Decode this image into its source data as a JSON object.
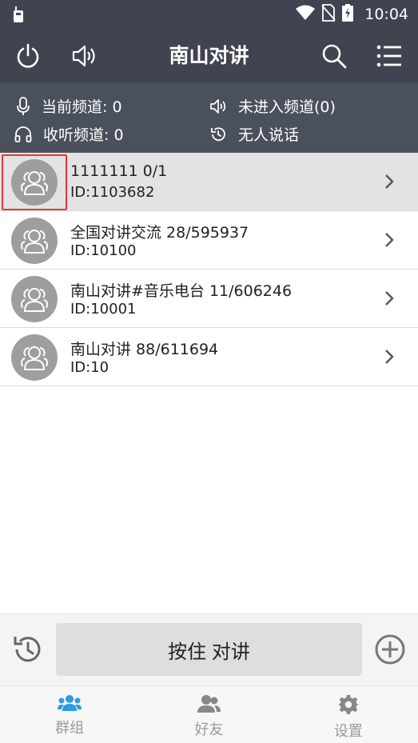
{
  "status_bar": {
    "time": "10:04",
    "icons": [
      "walkie-talkie-icon",
      "wifi-icon",
      "no-sim-icon",
      "battery-charging-icon"
    ]
  },
  "header": {
    "title": "南山对讲",
    "icons": [
      "power-icon",
      "speaker-icon",
      "search-icon",
      "menu-list-icon"
    ]
  },
  "info": {
    "current_channel": "当前频道: 0",
    "listen_channel": "收听频道: 0",
    "entered_channel": "未进入频道(0)",
    "talker": "无人说话"
  },
  "channels": [
    {
      "name": "1111111 0/1",
      "id": "ID:1103682",
      "selected": true
    },
    {
      "name": "全国对讲交流 28/595937",
      "id": "ID:10100",
      "selected": false
    },
    {
      "name": "南山对讲#音乐电台 11/606246",
      "id": "ID:10001",
      "selected": false
    },
    {
      "name": "南山对讲 88/611694",
      "id": "ID:10",
      "selected": false
    }
  ],
  "ptt": {
    "label": "按住 对讲"
  },
  "nav": {
    "tabs": [
      {
        "label": "群组",
        "active": true
      },
      {
        "label": "好友",
        "active": false
      },
      {
        "label": "设置",
        "active": false
      }
    ]
  },
  "colors": {
    "header_bg": "#3f4450",
    "info_bg": "#4a505c",
    "accent": "#2f9be0",
    "highlight": "#e53935"
  }
}
